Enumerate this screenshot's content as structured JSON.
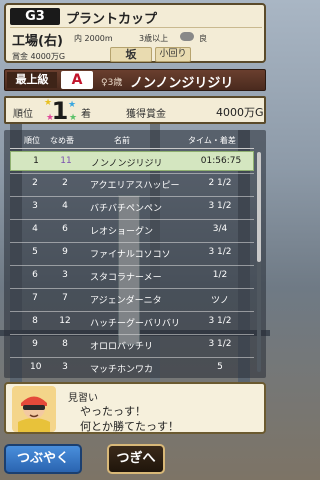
{
  "race": {
    "grade": "G3",
    "name": "プラントカップ",
    "course": "工場(右)",
    "distance": "内 2000m",
    "age_condition": "3歳以上",
    "track_condition": "良",
    "prize": "賞金 4000万G",
    "slope": "坂",
    "turn": "小回り"
  },
  "horse": {
    "class": "最上級",
    "rank": "A",
    "info": "♀3歳",
    "name": "ノンノンジリジリ"
  },
  "result": {
    "place_label": "順位",
    "place": "1",
    "place_suffix": "着",
    "earnings_label": "獲得賞金",
    "earnings": "4000万G"
  },
  "table": {
    "headers": [
      "順位",
      "なめ番",
      "名前",
      "タイム・着差"
    ],
    "rows": [
      {
        "pos": "1",
        "num": "11",
        "name": "ノンノンジリジリ",
        "time": "01:56:75"
      },
      {
        "pos": "2",
        "num": "2",
        "name": "アクエリアスハッピー",
        "time": "2 1/2"
      },
      {
        "pos": "3",
        "num": "4",
        "name": "バチバチペンペン",
        "time": "3 1/2"
      },
      {
        "pos": "4",
        "num": "6",
        "name": "レオショーグン",
        "time": "3/4"
      },
      {
        "pos": "5",
        "num": "9",
        "name": "ファイナルコソコソ",
        "time": "3 1/2"
      },
      {
        "pos": "6",
        "num": "3",
        "name": "スタコラナーメー",
        "time": "1/2"
      },
      {
        "pos": "7",
        "num": "7",
        "name": "アジェンダーニタ",
        "time": "ツノ"
      },
      {
        "pos": "8",
        "num": "12",
        "name": "ハッチーグーバリバリ",
        "time": "3 1/2"
      },
      {
        "pos": "9",
        "num": "8",
        "name": "オロロバッチリ",
        "time": "3 1/2"
      },
      {
        "pos": "10",
        "num": "3",
        "name": "マッチホンワカ",
        "time": "5"
      }
    ]
  },
  "dialog": {
    "speaker": "見習い",
    "line1": "やったっす！",
    "line2": "何とか勝てたっす！"
  },
  "buttons": {
    "tweet": "つぶやく",
    "next": "つぎへ"
  },
  "colors": {
    "winner_row": "#d4e6c0",
    "rank_letter": "#c2142b",
    "tweet_button": "#2a64b0"
  }
}
